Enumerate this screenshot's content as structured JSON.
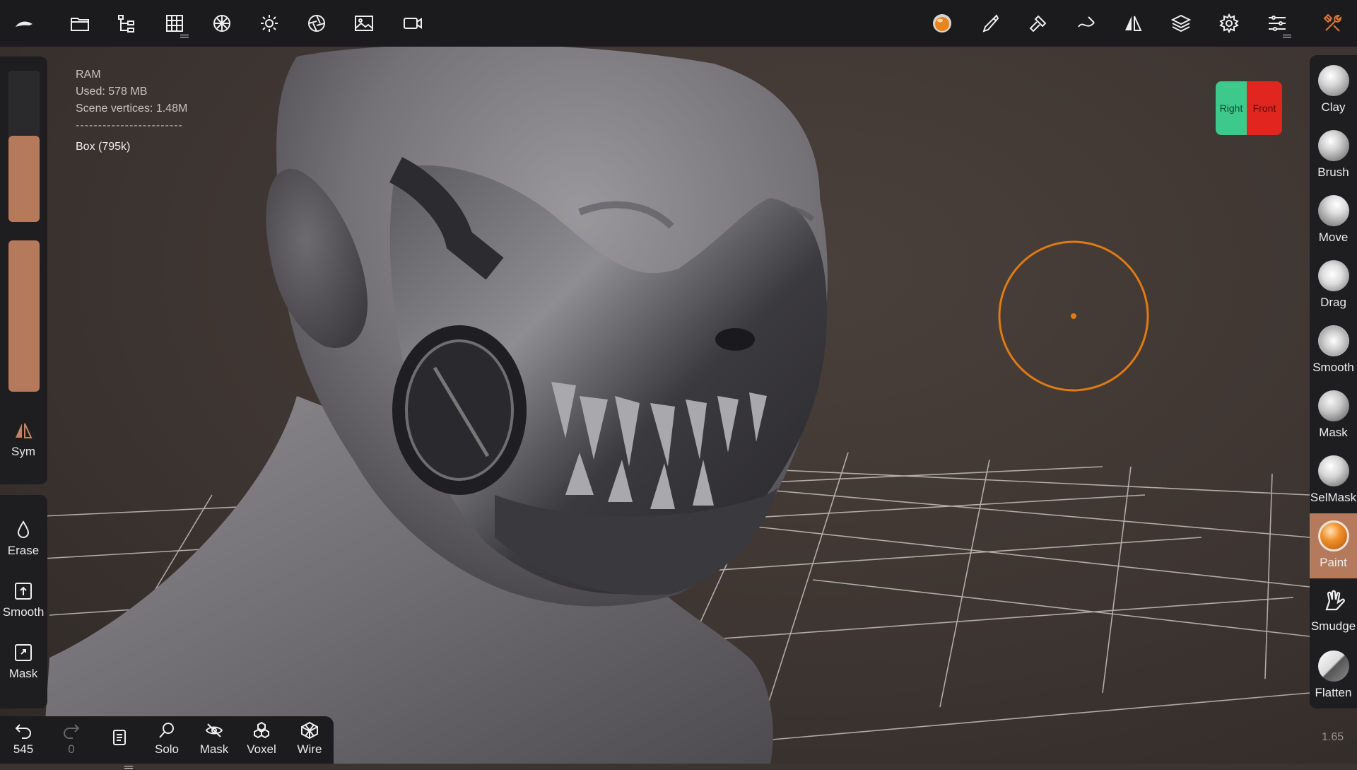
{
  "colors": {
    "accent": "#b57a5c",
    "cursor": "#e07a14",
    "gizmo_right": "#3cc98b",
    "gizmo_front": "#e1261f"
  },
  "topbar": {
    "left_icons": [
      "app-logo-icon",
      "folder-icon",
      "scene-tree-icon",
      "grid-icon",
      "material-icon",
      "light-icon",
      "aperture-icon",
      "image-icon",
      "video-camera-icon"
    ],
    "right_icons": [
      "paint-material-icon",
      "brush-icon",
      "hammer-icon",
      "stroke-icon",
      "symmetry-icon",
      "layers-icon",
      "settings-icon",
      "sliders-icon",
      "tools-icon"
    ]
  },
  "info": {
    "ram_label": "RAM",
    "used": "Used: 578 MB",
    "vertices": "Scene vertices: 1.48M",
    "divider": "------------------------",
    "mesh": "Box (795k)"
  },
  "left": {
    "sym_label": "Sym",
    "radius_level": 0.57,
    "intensity_level": 1.0,
    "erase_label": "Erase",
    "smooth_label": "Smooth",
    "mask_label": "Mask"
  },
  "bottom": {
    "undo_count": "545",
    "redo_count": "0",
    "solo_label": "Solo",
    "mask_label": "Mask",
    "voxel_label": "Voxel",
    "wire_label": "Wire"
  },
  "gizmo": {
    "right": "Right",
    "front": "Front"
  },
  "tools": [
    {
      "label": "Clay",
      "active": false
    },
    {
      "label": "Brush",
      "active": false
    },
    {
      "label": "Move",
      "active": false
    },
    {
      "label": "Drag",
      "active": false
    },
    {
      "label": "Smooth",
      "active": false
    },
    {
      "label": "Mask",
      "active": false
    },
    {
      "label": "SelMask",
      "active": false
    },
    {
      "label": "Paint",
      "active": true
    },
    {
      "label": "Smudge",
      "active": false
    },
    {
      "label": "Flatten",
      "active": false
    }
  ],
  "zoom": "1.65"
}
